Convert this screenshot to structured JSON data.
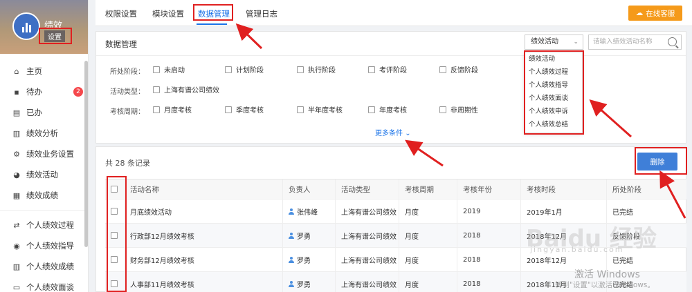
{
  "sidebar": {
    "title": "绩效",
    "settings_label": "设置",
    "items": [
      {
        "label": "主页",
        "icon": "home-icon"
      },
      {
        "label": "待办",
        "icon": "todo-icon",
        "badge": "2"
      },
      {
        "label": "已办",
        "icon": "done-icon"
      },
      {
        "label": "绩效分析",
        "icon": "bar-chart-icon"
      },
      {
        "label": "绩效业务设置",
        "icon": "settings-gear-icon"
      },
      {
        "label": "绩效活动",
        "icon": "pie-chart-icon"
      },
      {
        "label": "绩效成绩",
        "icon": "list-doc-icon"
      },
      {
        "label": "个人绩效过程",
        "icon": "cycle-icon"
      },
      {
        "label": "个人绩效指导",
        "icon": "compass-icon"
      },
      {
        "label": "个人绩效成绩",
        "icon": "bar-chart-icon"
      },
      {
        "label": "个人绩效面谈",
        "icon": "chat-icon"
      }
    ]
  },
  "topnav": {
    "tabs": [
      "权限设置",
      "模块设置",
      "数据管理",
      "管理日志"
    ],
    "active_tab": "数据管理",
    "service_button": "在线客服"
  },
  "data_panel": {
    "title": "数据管理",
    "activity_select_value": "绩效活动",
    "search_placeholder": "请输入绩效活动名称",
    "filters": {
      "stage_label": "所处阶段：",
      "stage_options": [
        "未启动",
        "计划阶段",
        "执行阶段",
        "考评阶段",
        "反馈阶段"
      ],
      "type_label": "活动类型：",
      "type_options": [
        "上海有谱公司绩效"
      ],
      "cycle_label": "考核周期：",
      "cycle_options": [
        "月度考核",
        "季度考核",
        "半年度考核",
        "年度考核",
        "非周期性"
      ]
    },
    "more_conditions": "更多条件"
  },
  "dropdown": {
    "options": [
      "绩效活动",
      "个人绩效过程",
      "个人绩效指导",
      "个人绩效面谈",
      "个人绩效申诉",
      "个人绩效总结"
    ]
  },
  "records": {
    "count_text": "共 28 条记录",
    "delete_button": "删除",
    "columns": [
      "活动名称",
      "负责人",
      "活动类型",
      "考核周期",
      "考核年份",
      "考核时段",
      "所处阶段"
    ],
    "rows": [
      [
        "月底绩效活动",
        "张伟峰",
        "上海有谱公司绩效",
        "月度",
        "2019",
        "2019年1月",
        "已完结"
      ],
      [
        "行政部12月绩效考核",
        "罗勇",
        "上海有谱公司绩效",
        "月度",
        "2018",
        "2018年12月",
        "反馈阶段"
      ],
      [
        "财务部12月绩效考核",
        "罗勇",
        "上海有谱公司绩效",
        "月度",
        "2018",
        "2018年12月",
        "已完结"
      ],
      [
        "人事部11月绩效考核",
        "罗勇",
        "上海有谱公司绩效",
        "月度",
        "2018",
        "2018年11月",
        "已完结"
      ]
    ]
  },
  "watermark": {
    "baidu": "Baidu 经验",
    "jingyan": "jingyan.baidu.com",
    "windows_line1": "激活 Windows",
    "windows_line2": "转到\"设置\"以激活 Windows。"
  },
  "colors": {
    "accent": "#1a73e8",
    "annotation": "#e02020",
    "service_orange": "#f59a1a",
    "delete_blue": "#3f7fd8"
  }
}
